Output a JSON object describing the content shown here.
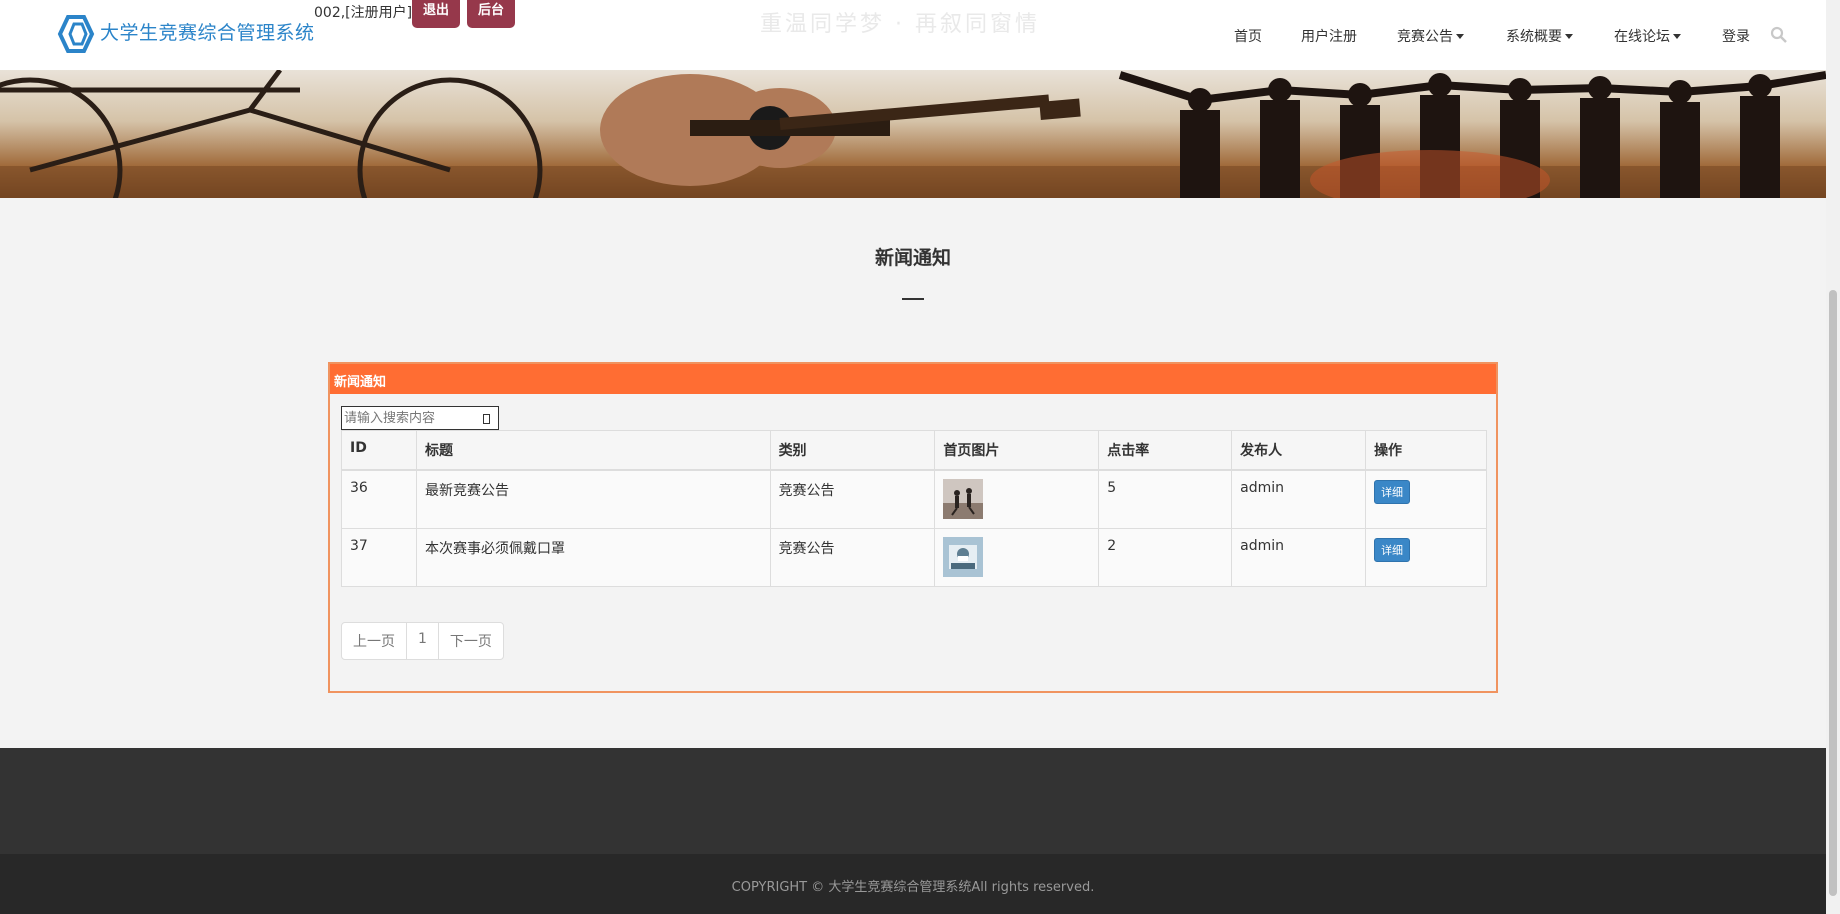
{
  "header": {
    "brand": "大学生竞赛综合管理系统",
    "user_info": "002,[注册用户]",
    "logout_label": "退出",
    "admin_label": "后台",
    "watermark": "重温同学梦 · 再叙同窗情",
    "nav": [
      {
        "label": "首页",
        "dropdown": false
      },
      {
        "label": "用户注册",
        "dropdown": false
      },
      {
        "label": "竞赛公告",
        "dropdown": true
      },
      {
        "label": "系统概要",
        "dropdown": true
      },
      {
        "label": "在线论坛",
        "dropdown": true
      },
      {
        "label": "登录",
        "dropdown": false
      }
    ]
  },
  "section": {
    "title": "新闻通知"
  },
  "panel": {
    "title": "新闻通知",
    "search_placeholder": "请输入搜索内容",
    "columns": [
      "ID",
      "标题",
      "类别",
      "首页图片",
      "点击率",
      "发布人",
      "操作"
    ],
    "rows": [
      {
        "id": "36",
        "title": "最新竞赛公告",
        "category": "竞赛公告",
        "image_icon": "thumbnail-people-running",
        "clicks": "5",
        "publisher": "admin",
        "action": "详细"
      },
      {
        "id": "37",
        "title": "本次赛事必须佩戴口罩",
        "category": "竞赛公告",
        "image_icon": "thumbnail-masked-person",
        "clicks": "2",
        "publisher": "admin",
        "action": "详细"
      }
    ],
    "pager": {
      "prev": "上一页",
      "page": "1",
      "next": "下一页"
    }
  },
  "footer": {
    "copyright": "COPYRIGHT © 大学生竞赛综合管理系统All rights reserved."
  },
  "colors": {
    "brand_blue": "#2b84c9",
    "header_button": "#96384b",
    "panel_orange": "#ff6d33",
    "detail_button": "#3a87c7",
    "footer_dark": "#333333"
  }
}
